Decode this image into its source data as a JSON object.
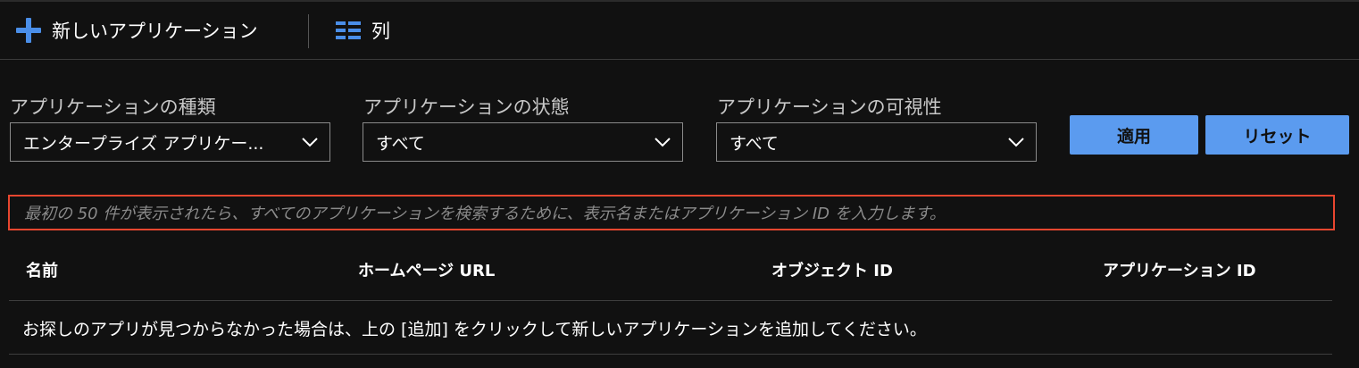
{
  "toolbar": {
    "new_app_label": "新しいアプリケーション",
    "columns_label": "列"
  },
  "filters": {
    "app_type": {
      "label": "アプリケーションの種類",
      "value": "エンタープライズ アプリケー..."
    },
    "app_status": {
      "label": "アプリケーションの状態",
      "value": "すべて"
    },
    "app_visibility": {
      "label": "アプリケーションの可視性",
      "value": "すべて"
    }
  },
  "actions": {
    "apply_label": "適用",
    "reset_label": "リセット"
  },
  "search_hint": "最初の 50 件が表示されたら、すべてのアプリケーションを検索するために、表示名またはアプリケーション ID を入力します。",
  "table": {
    "columns": [
      "名前",
      "ホームページ URL",
      "オブジェクト ID",
      "アプリケーション ID"
    ],
    "empty_message": "お探しのアプリが見つからなかった場合は、上の [追加] をクリックして新しいアプリケーションを追加してください。"
  },
  "colors": {
    "accent": "#4a8ee8",
    "button": "#5b9bef",
    "highlight_border": "#e8462f",
    "background": "#111111"
  }
}
